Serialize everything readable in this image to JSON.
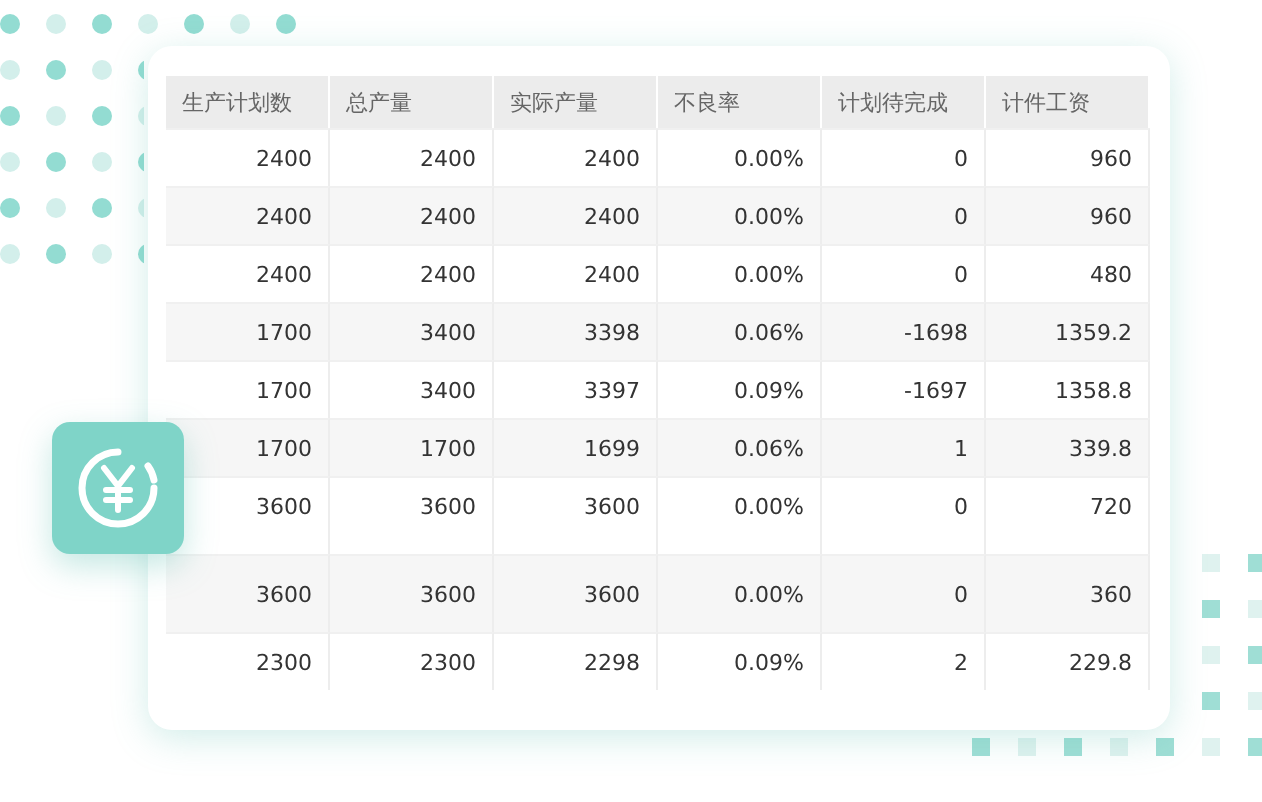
{
  "table": {
    "columns": [
      "生产计划数",
      "总产量",
      "实际产量",
      "不良率",
      "计划待完成",
      "计件工资"
    ],
    "rows": [
      [
        "2400",
        "2400",
        "2400",
        "0.00%",
        "0",
        "960"
      ],
      [
        "2400",
        "2400",
        "2400",
        "0.00%",
        "0",
        "960"
      ],
      [
        "2400",
        "2400",
        "2400",
        "0.00%",
        "0",
        "480"
      ],
      [
        "1700",
        "3400",
        "3398",
        "0.06%",
        "-1698",
        "1359.2"
      ],
      [
        "1700",
        "3400",
        "3397",
        "0.09%",
        "-1697",
        "1358.8"
      ],
      [
        "1700",
        "1700",
        "1699",
        "0.06%",
        "1",
        "339.8"
      ],
      [
        "3600",
        "3600",
        "3600",
        "0.00%",
        "0",
        "720"
      ],
      [
        "3600",
        "3600",
        "3600",
        "0.00%",
        "0",
        "360"
      ],
      [
        "2300",
        "2300",
        "2298",
        "0.09%",
        "2",
        "229.8"
      ]
    ]
  }
}
